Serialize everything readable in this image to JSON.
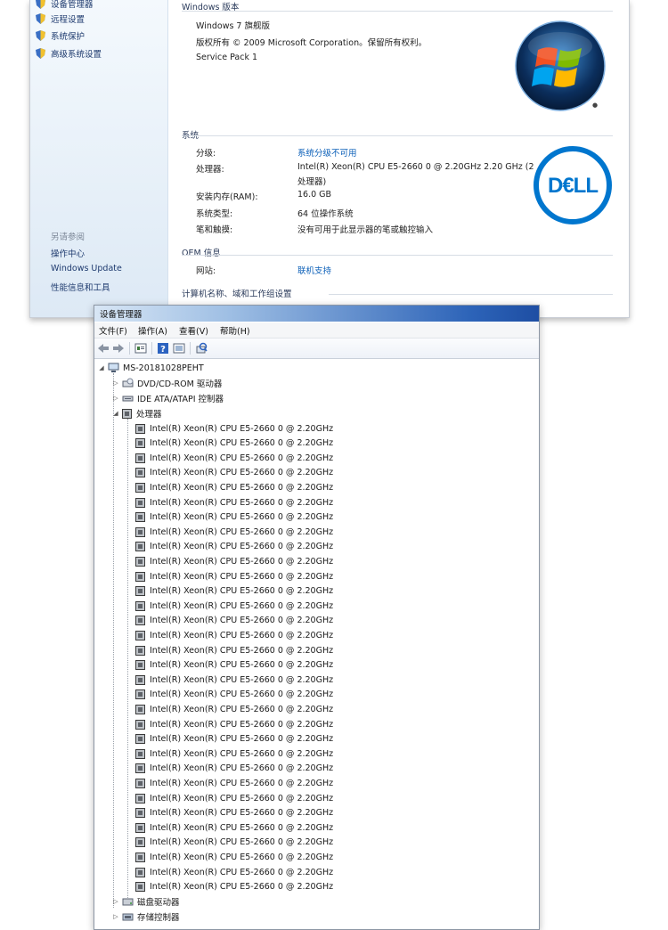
{
  "system_window": {
    "sidebar": {
      "links": [
        {
          "label": "设备管理器",
          "icon": "shield-icon"
        },
        {
          "label": "远程设置",
          "icon": "shield-icon"
        },
        {
          "label": "系统保护",
          "icon": "shield-icon"
        },
        {
          "label": "高级系统设置",
          "icon": "shield-icon"
        }
      ],
      "see_also_title": "另请参阅",
      "see_also": [
        "操作中心",
        "Windows Update",
        "性能信息和工具"
      ]
    },
    "windows_edition": {
      "title": "Windows 版本",
      "edition": "Windows 7 旗舰版",
      "copyright": "版权所有 © 2009 Microsoft Corporation。保留所有权利。",
      "service_pack": "Service Pack 1"
    },
    "system": {
      "title": "系统",
      "rating_label": "分级:",
      "rating_value": "系统分级不可用",
      "processor_label": "处理器:",
      "processor_value_line1": "Intel(R) Xeon(R) CPU E5-2660 0 @ 2.20GHz   2.20 GHz  (2",
      "processor_value_line2": "处理器)",
      "ram_label": "安装内存(RAM):",
      "ram_value": "16.0 GB",
      "type_label": "系统类型:",
      "type_value": "64 位操作系统",
      "pen_label": "笔和触摸:",
      "pen_value": "没有可用于此显示器的笔或触控输入"
    },
    "oem": {
      "title": "OEM 信息",
      "website_label": "网站:",
      "website_value": "联机支持"
    },
    "computer_name_title": "计算机名称、域和工作组设置"
  },
  "device_manager": {
    "title": "设备管理器",
    "menu": [
      "文件(F)",
      "操作(A)",
      "查看(V)",
      "帮助(H)"
    ],
    "toolbar_icons": [
      "back-arrow-icon",
      "forward-arrow-icon",
      "properties-icon",
      "help-icon",
      "update-driver-icon",
      "scan-hardware-icon"
    ],
    "computer_name": "MS-20181028PEHT",
    "categories_before": [
      {
        "label": "DVD/CD-ROM 驱动器",
        "icon": "dvd-drive-icon"
      },
      {
        "label": "IDE ATA/ATAPI 控制器",
        "icon": "ide-controller-icon"
      }
    ],
    "processor_category": "处理器",
    "processors": [
      "Intel(R) Xeon(R) CPU E5-2660 0 @ 2.20GHz",
      "Intel(R) Xeon(R) CPU E5-2660 0 @ 2.20GHz",
      "Intel(R) Xeon(R) CPU E5-2660 0 @ 2.20GHz",
      "Intel(R) Xeon(R) CPU E5-2660 0 @ 2.20GHz",
      "Intel(R) Xeon(R) CPU E5-2660 0 @ 2.20GHz",
      "Intel(R) Xeon(R) CPU E5-2660 0 @ 2.20GHz",
      "Intel(R) Xeon(R) CPU E5-2660 0 @ 2.20GHz",
      "Intel(R) Xeon(R) CPU E5-2660 0 @ 2.20GHz",
      "Intel(R) Xeon(R) CPU E5-2660 0 @ 2.20GHz",
      "Intel(R) Xeon(R) CPU E5-2660 0 @ 2.20GHz",
      "Intel(R) Xeon(R) CPU E5-2660 0 @ 2.20GHz",
      "Intel(R) Xeon(R) CPU E5-2660 0 @ 2.20GHz",
      "Intel(R) Xeon(R) CPU E5-2660 0 @ 2.20GHz",
      "Intel(R) Xeon(R) CPU E5-2660 0 @ 2.20GHz",
      "Intel(R) Xeon(R) CPU E5-2660 0 @ 2.20GHz",
      "Intel(R) Xeon(R) CPU E5-2660 0 @ 2.20GHz",
      "Intel(R) Xeon(R) CPU E5-2660 0 @ 2.20GHz",
      "Intel(R) Xeon(R) CPU E5-2660 0 @ 2.20GHz",
      "Intel(R) Xeon(R) CPU E5-2660 0 @ 2.20GHz",
      "Intel(R) Xeon(R) CPU E5-2660 0 @ 2.20GHz",
      "Intel(R) Xeon(R) CPU E5-2660 0 @ 2.20GHz",
      "Intel(R) Xeon(R) CPU E5-2660 0 @ 2.20GHz",
      "Intel(R) Xeon(R) CPU E5-2660 0 @ 2.20GHz",
      "Intel(R) Xeon(R) CPU E5-2660 0 @ 2.20GHz",
      "Intel(R) Xeon(R) CPU E5-2660 0 @ 2.20GHz",
      "Intel(R) Xeon(R) CPU E5-2660 0 @ 2.20GHz",
      "Intel(R) Xeon(R) CPU E5-2660 0 @ 2.20GHz",
      "Intel(R) Xeon(R) CPU E5-2660 0 @ 2.20GHz",
      "Intel(R) Xeon(R) CPU E5-2660 0 @ 2.20GHz",
      "Intel(R) Xeon(R) CPU E5-2660 0 @ 2.20GHz",
      "Intel(R) Xeon(R) CPU E5-2660 0 @ 2.20GHz",
      "Intel(R) Xeon(R) CPU E5-2660 0 @ 2.20GHz"
    ],
    "categories_after": [
      {
        "label": "磁盘驱动器",
        "icon": "disk-drive-icon"
      },
      {
        "label": "存储控制器",
        "icon": "storage-controller-icon"
      }
    ]
  },
  "colors": {
    "link_blue": "#0b5fb8",
    "dell_blue": "#0076ce",
    "titlebar_blue": "#2c63b8"
  }
}
